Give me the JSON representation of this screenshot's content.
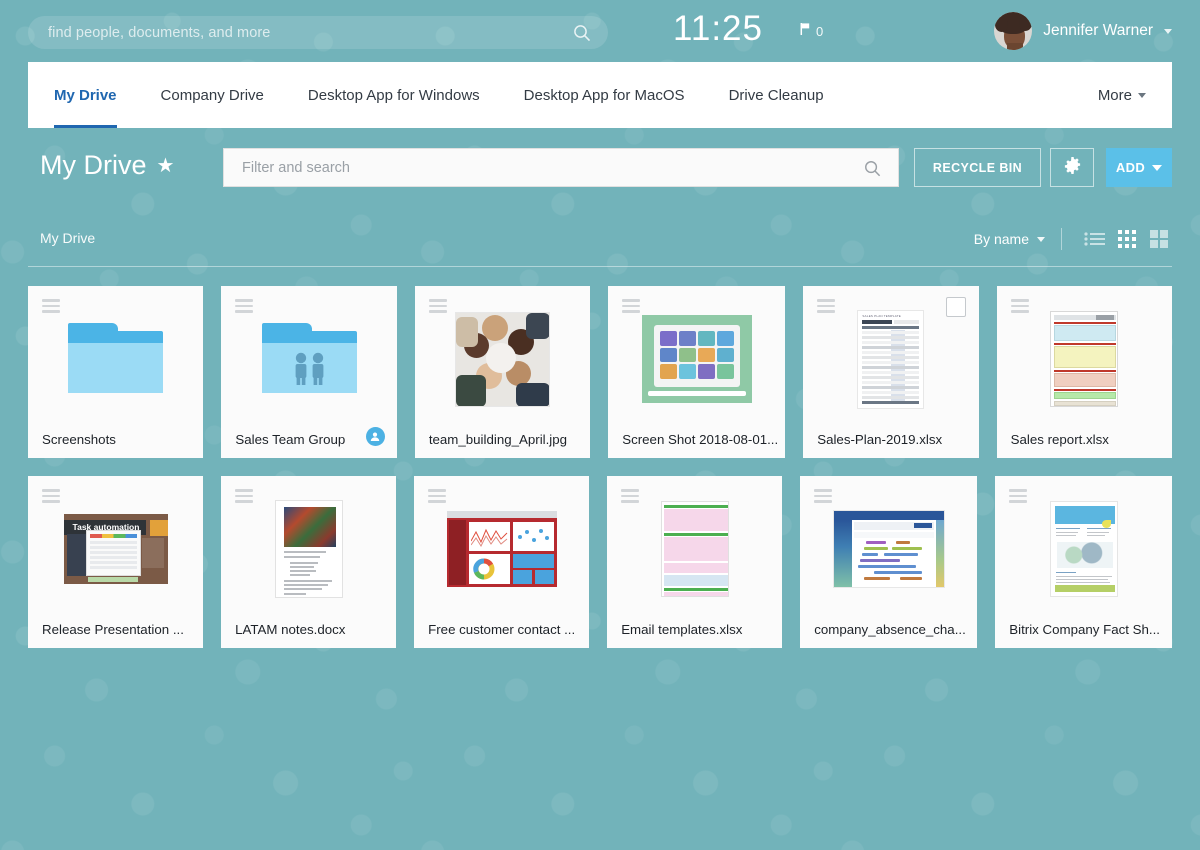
{
  "header": {
    "search_placeholder": "find people, documents, and more",
    "search_icon": "search-icon",
    "clock": "11:25",
    "flag_icon": "flag-icon",
    "flag_count": "0",
    "user_name": "Jennifer Warner",
    "user_caret_icon": "chevron-down-icon",
    "avatar_icon": "avatar"
  },
  "tabs": [
    {
      "label": "My Drive",
      "active": true
    },
    {
      "label": "Company Drive",
      "active": false
    },
    {
      "label": "Desktop App for Windows",
      "active": false
    },
    {
      "label": "Desktop App for MacOS",
      "active": false
    },
    {
      "label": "Drive Cleanup",
      "active": false
    }
  ],
  "tab_more": {
    "label": "More",
    "icon": "chevron-down-icon"
  },
  "toolbar": {
    "title": "My Drive",
    "star_icon": "star-icon",
    "filter_placeholder": "Filter and search",
    "filter_search_icon": "search-icon",
    "recycle_bin_label": "RECYCLE BIN",
    "gear_icon": "gear-icon",
    "add_label": "ADD",
    "add_caret_icon": "chevron-down-icon"
  },
  "breadcrumb": {
    "label": "My Drive"
  },
  "sort": {
    "label": "By name",
    "caret_icon": "chevron-down-icon",
    "views": [
      {
        "icon": "list-view-icon",
        "active": false
      },
      {
        "icon": "grid-view-icon",
        "active": true
      },
      {
        "icon": "tile-view-icon",
        "active": false
      }
    ]
  },
  "colors": {
    "background_teal": "#72b3ba",
    "accent_blue": "#2067b0",
    "add_button_blue": "#5bc0e8",
    "folder_blue": "#9bdbf5",
    "folder_tab_blue": "#4bb4e6",
    "card_background": "#fbfbfb",
    "badge_blue": "#4cb1e3"
  },
  "files": [
    {
      "name": "Screenshots",
      "type": "folder",
      "menu_icon": "card-menu-icon"
    },
    {
      "name": "Sales Team Group",
      "type": "shared-folder",
      "menu_icon": "card-menu-icon",
      "badge_icon": "group-icon"
    },
    {
      "name": "team_building_April.jpg",
      "type": "image",
      "menu_icon": "card-menu-icon"
    },
    {
      "name": "Screen Shot 2018-08-01...",
      "type": "image",
      "menu_icon": "card-menu-icon"
    },
    {
      "name": "Sales-Plan-2019.xlsx",
      "type": "spreadsheet",
      "menu_icon": "card-menu-icon",
      "checkbox": true,
      "checked": false
    },
    {
      "name": "Sales report.xlsx",
      "type": "spreadsheet",
      "menu_icon": "card-menu-icon"
    },
    {
      "name": "Release Presentation ...",
      "type": "presentation",
      "menu_icon": "card-menu-icon"
    },
    {
      "name": "LATAM notes.docx",
      "type": "document",
      "menu_icon": "card-menu-icon"
    },
    {
      "name": "Free customer contact ...",
      "type": "dashboard",
      "menu_icon": "card-menu-icon"
    },
    {
      "name": "Email templates.xlsx",
      "type": "spreadsheet",
      "menu_icon": "card-menu-icon"
    },
    {
      "name": "company_absence_cha...",
      "type": "gantt",
      "menu_icon": "card-menu-icon"
    },
    {
      "name": "Bitrix Company Fact Sh...",
      "type": "document",
      "menu_icon": "card-menu-icon"
    }
  ]
}
